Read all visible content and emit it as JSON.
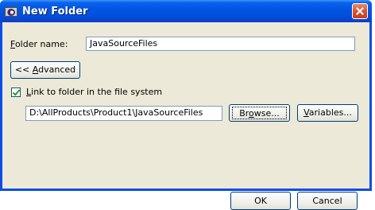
{
  "window": {
    "title": "New Folder"
  },
  "folder_name": {
    "label_underlined": "F",
    "label_rest": "older name:",
    "value": "JavaSourceFiles"
  },
  "advanced_button": {
    "prefix": "<< ",
    "underlined": "A",
    "rest": "dvanced"
  },
  "link_checkbox": {
    "checked": true,
    "underlined": "L",
    "rest": "ink to folder in the file system"
  },
  "path_field": {
    "value": "D:\\AllProducts\\Product1\\JavaSourceFiles"
  },
  "browse_button": {
    "pre": "Br",
    "underlined": "o",
    "rest": "wse..."
  },
  "variables_button": {
    "underlined": "V",
    "rest": "ariables..."
  },
  "ok_button": {
    "label": "OK"
  },
  "cancel_button": {
    "label": "Cancel"
  },
  "colors": {
    "titlebar": "#0054e3",
    "dialog_bg": "#ece9d8",
    "close_button": "#d2532e",
    "check_mark": "#21a121"
  }
}
